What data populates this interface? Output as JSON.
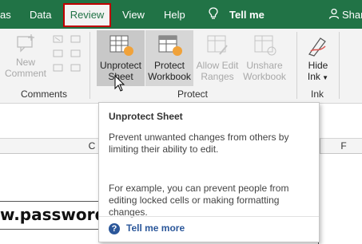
{
  "tabs": {
    "partial_left": "as",
    "data": "Data",
    "review": "Review",
    "view": "View",
    "help": "Help",
    "tell_me": "Tell me",
    "share_partial": "Shar"
  },
  "ribbon": {
    "new_comment_line1": "New",
    "new_comment_line2": "Comment",
    "unprotect_sheet_line1": "Unprotect",
    "unprotect_sheet_line2": "Sheet",
    "protect_workbook_line1": "Protect",
    "protect_workbook_line2": "Workbook",
    "allow_edit_line1": "Allow Edit",
    "allow_edit_line2": "Ranges",
    "unshare_line1": "Unshare",
    "unshare_line2": "Workbook",
    "hide_ink_line1": "Hide",
    "hide_ink_line2": "Ink",
    "group_comments": "Comments",
    "group_protect": "Protect",
    "group_ink": "Ink"
  },
  "columns": [
    "C",
    "D",
    "E",
    "F"
  ],
  "sheet": {
    "cell_text": "w.passwordsre"
  },
  "tooltip": {
    "title": "Unprotect Sheet",
    "body1": "Prevent unwanted changes from others by limiting their ability to edit.",
    "body2": "For example, you can prevent people from editing locked cells or making formatting changes.",
    "link": "Tell me more"
  },
  "colors": {
    "tab_bar": "#217346",
    "review_outline": "#c00000",
    "accent_orange": "#f0a23a",
    "link_blue": "#2b579a"
  },
  "icons": [
    "lightbulb-icon",
    "person-icon",
    "help-icon",
    "protect-sheet-icon",
    "protect-workbook-icon",
    "hide-ink-icon",
    "mouse-pointer-icon"
  ]
}
